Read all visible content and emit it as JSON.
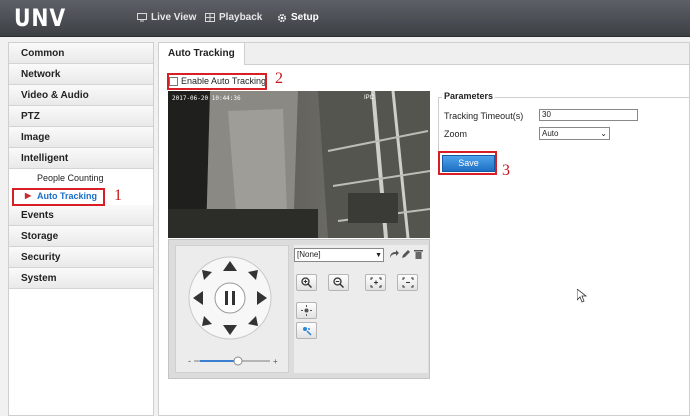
{
  "brand": {
    "logo": "UNV"
  },
  "topnav": {
    "live_view": "Live View",
    "playback": "Playback",
    "setup": "Setup"
  },
  "sidebar": {
    "items": [
      {
        "label": "Common"
      },
      {
        "label": "Network"
      },
      {
        "label": "Video & Audio"
      },
      {
        "label": "PTZ"
      },
      {
        "label": "Image"
      },
      {
        "label": "Intelligent"
      }
    ],
    "sub_items": [
      {
        "label": "People Counting"
      },
      {
        "label": "Auto Tracking"
      }
    ],
    "items_after": [
      {
        "label": "Events"
      },
      {
        "label": "Storage"
      },
      {
        "label": "Security"
      },
      {
        "label": "System"
      }
    ]
  },
  "main": {
    "tab": "Auto Tracking",
    "enable_label": "Enable Auto Tracking",
    "video": {
      "osd_time": "2017-06-20 10:44:36",
      "osd_name": "IPC"
    },
    "ptz": {
      "preset_value": "[None]"
    },
    "parameters": {
      "title": "Parameters",
      "timeout_label": "Tracking Timeout(s)",
      "timeout_value": "30",
      "zoom_label": "Zoom",
      "zoom_value": "Auto"
    },
    "save_label": "Save"
  },
  "annotations": {
    "n1": "1",
    "n2": "2",
    "n3": "3",
    "color": "#d81f26"
  },
  "colors": {
    "accent": "#1a6fc9",
    "topbar": "#4a4d52",
    "save_button": "#2a84d8"
  }
}
